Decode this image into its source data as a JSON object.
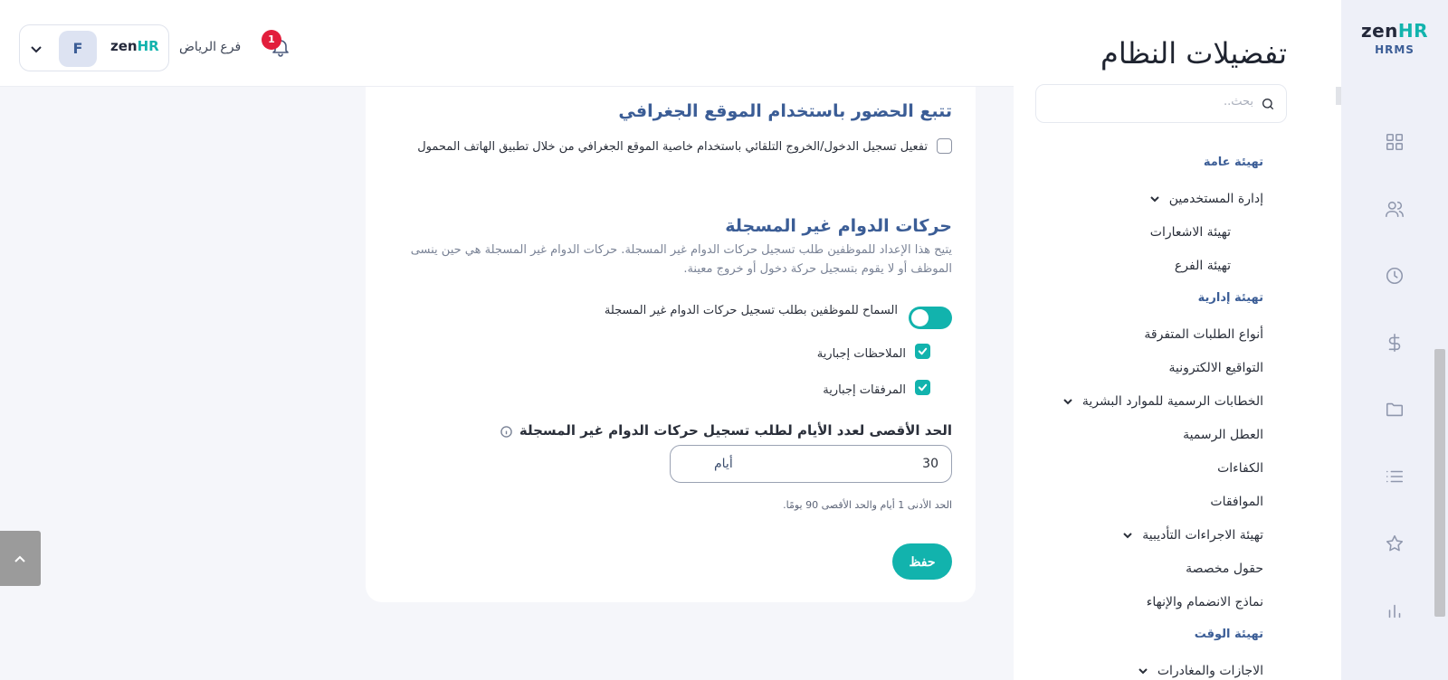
{
  "brand": {
    "logo_zen": "zen",
    "logo_hr": "HR",
    "product": "HRMS"
  },
  "rail": {
    "icons": [
      "dashboard-icon",
      "users-icon",
      "clock-icon",
      "dollar-icon",
      "folder-icon",
      "list-icon",
      "star-icon",
      "chart-icon"
    ]
  },
  "nav": {
    "title": "تفضيلات النظام",
    "search_placeholder": "بحث..",
    "section_general": "تهيئة عامة",
    "item_users": "إدارة المستخدمين",
    "item_notifications": "تهيئة الاشعارات",
    "item_branch": "تهيئة الفرع",
    "section_admin": "تهيئة إدارية",
    "item_misc_requests": "أنواع الطلبات المتفرقة",
    "item_esign": "التواقيع الالكترونية",
    "item_hr_letters": "الخطابات الرسمية للموارد البشرية",
    "item_holidays": "العطل الرسمية",
    "item_competencies": "الكفاءات",
    "item_approvals": "الموافقات",
    "item_disciplinary": "تهيئة الاجراءات التأديبية",
    "item_custom_fields": "حقول مخصصة",
    "item_onboarding": "نماذج الانضمام والإنهاء",
    "section_time": "تهيئة الوقت",
    "item_leaves_partial": "الاجازات والمغادرات"
  },
  "topbar": {
    "avatar_initial": "F",
    "branch_logo_zen": "zen",
    "branch_logo_hr": "HR",
    "branch_name": "فرع الرياض",
    "notification_count": "1"
  },
  "geo": {
    "title": "تتبع الحضور باستخدام الموقع الجغرافي",
    "checkbox_label": "تفعيل تسجيل الدخول/الخروج التلقائي باستخدام خاصية الموقع الجغرافي من خلال تطبيق الهاتف المحمول",
    "checkbox_checked": false
  },
  "unrecorded": {
    "title": "حركات الدوام غير المسجلة",
    "description": "يتيح هذا الإعداد للموظفين طلب تسجيل حركات الدوام غير المسجلة. حركات الدوام غير المسجلة هي حين ينسى الموظف أو لا يقوم بتسجيل حركة دخول أو خروج معينة.",
    "toggle_label": "السماح للموظفين بطلب تسجيل حركات الدوام غير المسجلة",
    "toggle_on": true,
    "notes_required_label": "الملاحظات إجبارية",
    "attachments_required_label": "المرفقات إجبارية",
    "max_days_label": "الحد الأقصى لعدد الأيام لطلب تسجيل حركات الدوام غير المسجلة",
    "max_days_value": "30",
    "max_days_unit": "أيام",
    "hint": "الحد الأدنى 1 أيام والحد الأقصى 90 يومًا.",
    "save_label": "حفظ"
  },
  "colors": {
    "accent": "#12b3ad",
    "heading": "#3b5d96",
    "badge": "#e21e3c"
  }
}
